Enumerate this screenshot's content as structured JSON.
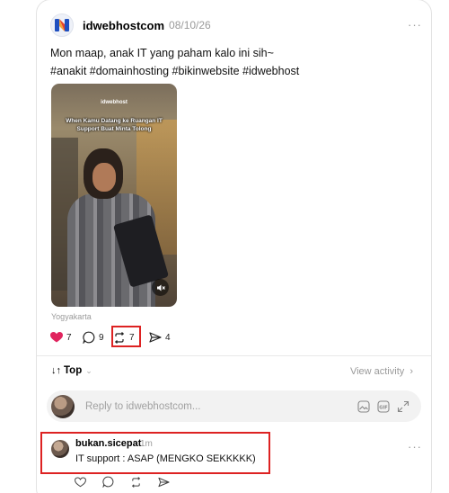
{
  "post": {
    "username": "idwebhostcom",
    "timestamp": "08/10/26",
    "more": "···",
    "text_line1": "Mon maap, anak IT yang paham kalo ini sih~",
    "text_line2": "#anakit #domainhosting #bikinwebsite #idwebhost",
    "video": {
      "brand": "idwebhost",
      "caption": "When Kamu Datang ke Ruangan IT Support Buat Minta Tolong"
    },
    "location": "Yogyakarta",
    "actions": {
      "likes": "7",
      "comments": "9",
      "reposts": "7",
      "shares": "4"
    },
    "colors": {
      "like": "#e0245e",
      "highlight": "#dd2222"
    }
  },
  "activity": {
    "sort_label": "Top",
    "sort_icon": "↓↑",
    "view_activity": "View activity"
  },
  "reply": {
    "placeholder": "Reply to idwebhostcom..."
  },
  "comment": {
    "username": "bukan.sicepat",
    "time": "1m",
    "text": "IT support : ASAP (MENGKO SEKKKKK)",
    "more": "···"
  }
}
